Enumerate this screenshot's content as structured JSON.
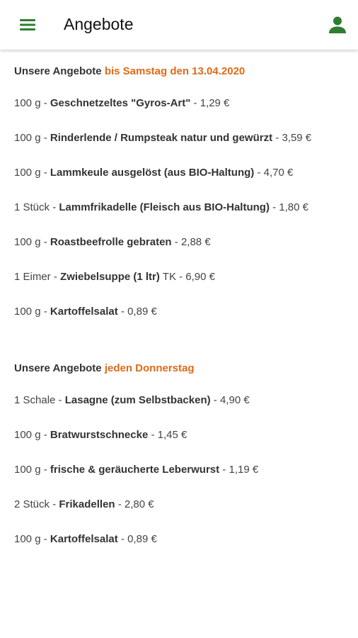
{
  "header": {
    "title": "Angebote",
    "menu_icon": "hamburger-menu-icon",
    "account_icon": "user-account-icon",
    "accent_color": "#2e7d32"
  },
  "sections": [
    {
      "heading_prefix": "Unsere Angebote ",
      "heading_highlight": "bis Samstag den 13.04.2020",
      "items": [
        {
          "qty": "100 g",
          "sep1": " - ",
          "name": "Geschnetzeltes \"Gyros-Art\"",
          "sep2": " - ",
          "price": "1,29 €"
        },
        {
          "qty": "100 g",
          "sep1": " - ",
          "name": "Rinderlende / Rumpsteak natur und gewürzt",
          "sep2": " - ",
          "price": "3,59 €"
        },
        {
          "qty": "100 g",
          "sep1": " - ",
          "name": "Lammkeule ausgelöst (aus BIO-Haltung)",
          "sep2": " - ",
          "price": "4,70 €"
        },
        {
          "qty": "1 Stück",
          "sep1": " - ",
          "name": "Lammfrikadelle (Fleisch aus BIO-Haltung)",
          "sep2": " - ",
          "price": "1,80 €"
        },
        {
          "qty": "100 g",
          "sep1": " - ",
          "name": "Roastbeefrolle gebraten",
          "sep2": " - ",
          "price": "2,88 €"
        },
        {
          "qty": "1 Eimer",
          "sep1": " - ",
          "name": "Zwiebelsuppe (1 ltr)",
          "sep2": " TK - ",
          "price": "6,90 €"
        },
        {
          "qty": "100 g",
          "sep1": " - ",
          "name": "Kartoffelsalat",
          "sep2": " - ",
          "price": "0,89 €"
        }
      ]
    },
    {
      "heading_prefix": "Unsere Angebote ",
      "heading_highlight": "jeden Donnerstag",
      "items": [
        {
          "qty": "1 Schale",
          "sep1": " - ",
          "name": "Lasagne (zum Selbstbacken)",
          "sep2": " - ",
          "price": "4,90 €"
        },
        {
          "qty": "100 g",
          "sep1": " - ",
          "name": "Bratwurstschnecke",
          "sep2": " - ",
          "price": "1,45 €"
        },
        {
          "qty": "100 g",
          "sep1": " - ",
          "name": "frische & geräucherte Leberwurst",
          "sep2": " - ",
          "price": "1,19 €"
        },
        {
          "qty": "2 Stück",
          "sep1": " - ",
          "name": "Frikadellen",
          "sep2": " - ",
          "price": "2,80 €"
        },
        {
          "qty": "100 g",
          "sep1": " - ",
          "name": "Kartoffelsalat",
          "sep2": " - ",
          "price": "0,89 €"
        }
      ]
    }
  ]
}
